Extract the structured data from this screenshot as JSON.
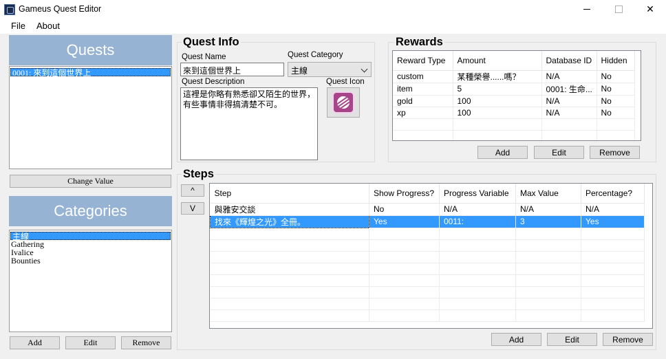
{
  "window": {
    "title": "Gameus Quest Editor",
    "close_glyph": "✕"
  },
  "menu": [
    {
      "label": "File"
    },
    {
      "label": "About"
    }
  ],
  "quests_panel": {
    "header": "Quests",
    "items": [
      {
        "label": "0001: 來到這個世界上",
        "selected": true
      }
    ],
    "change_value_label": "Change Value"
  },
  "categories_panel": {
    "header": "Categories",
    "items": [
      {
        "label": "主線",
        "selected": true
      },
      {
        "label": "Gathering"
      },
      {
        "label": "Ivalice"
      },
      {
        "label": "Bounties"
      }
    ],
    "add_label": "Add",
    "edit_label": "Edit",
    "remove_label": "Remove"
  },
  "quest_info": {
    "title": "Quest Info",
    "name_label": "Quest Name",
    "name_value": "來到這個世界上",
    "category_label": "Quest Category",
    "category_value": "主線",
    "description_label": "Quest Description",
    "description_value": "這裡是你略有熟悉卻又陌生的世界，有些事情非得搞清楚不可。",
    "icon_label": "Quest Icon",
    "icon_name": "yarn-ball-icon"
  },
  "rewards": {
    "title": "Rewards",
    "columns": [
      "Reward Type",
      "Amount",
      "Database ID",
      "Hidden"
    ],
    "rows": [
      [
        "custom",
        "某種榮譽......嗎？",
        "N/A",
        "No"
      ],
      [
        "item",
        "5",
        "0001: 生命...",
        "No"
      ],
      [
        "gold",
        "100",
        "N/A",
        "No"
      ],
      [
        "xp",
        "100",
        "N/A",
        "No"
      ]
    ],
    "add_label": "Add",
    "edit_label": "Edit",
    "remove_label": "Remove"
  },
  "steps": {
    "title": "Steps",
    "up_glyph": "^",
    "down_glyph": "V",
    "columns": [
      "Step",
      "Show Progress?",
      "Progress Variable",
      "Max Value",
      "Percentage?"
    ],
    "rows": [
      {
        "cells": [
          "與雅安交談",
          "No",
          "N/A",
          "N/A",
          "N/A"
        ],
        "selected": false
      },
      {
        "cells": [
          "找來《輝煌之光》全冊。",
          "Yes",
          "0011:",
          "3",
          "Yes"
        ],
        "selected": true
      }
    ],
    "add_label": "Add",
    "edit_label": "Edit",
    "remove_label": "Remove"
  },
  "colors": {
    "header_blue": "#97b3d4",
    "selection": "#3399ff",
    "window_bg": "#f0f0f0"
  }
}
